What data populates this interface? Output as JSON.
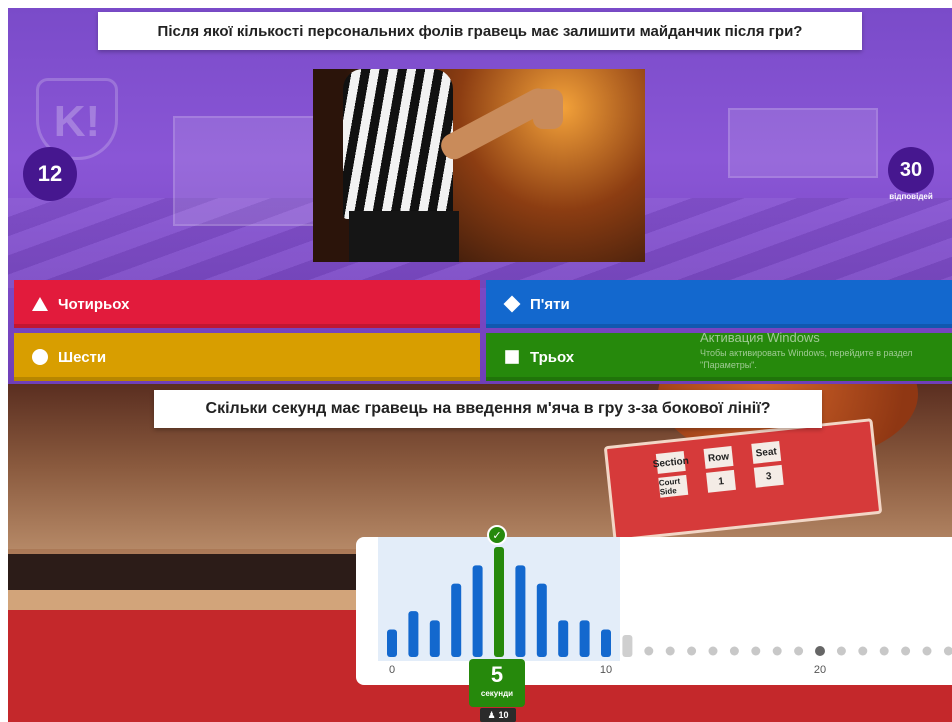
{
  "top_quiz": {
    "question": "Після якої кількості персональних фолів гравець має залишити майданчик після гри?",
    "timer": "12",
    "answers_count": "30",
    "answers_label": "відповідей",
    "crest_text": "K!",
    "answers": [
      {
        "label": "Чотирьох",
        "shape": "triangle-icon",
        "color": "#e21b3c"
      },
      {
        "label": "П'яти",
        "shape": "diamond-icon",
        "color": "#1368ce"
      },
      {
        "label": "Шести",
        "shape": "circle-icon",
        "color": "#d89e00"
      },
      {
        "label": "Трьох",
        "shape": "square-icon",
        "color": "#26890c"
      }
    ],
    "activation": {
      "title": "Активация Windows",
      "text": "Чтобы активировать Windows, перейдите в раздел \"Параметры\"."
    }
  },
  "bottom_quiz": {
    "question": "Скільки секунд має гравець на введення м'яча в гру з-за бокової лінії?",
    "tickets": [
      {
        "a": "Section",
        "b": "Court Side",
        "c": "Row",
        "d": "1",
        "e": "Seat",
        "f": "3"
      }
    ],
    "answer_value": "5",
    "answer_unit": "секунди",
    "voters": "10",
    "accent_green": "#26890c",
    "accent_blue": "#1368ce"
  },
  "chart_data": {
    "type": "bar",
    "x": [
      0,
      1,
      2,
      3,
      4,
      5,
      6,
      7,
      8,
      9,
      10
    ],
    "values": [
      3,
      5,
      4,
      8,
      10,
      12,
      10,
      8,
      4,
      4,
      3
    ],
    "highlighted_x": 5,
    "xticks": [
      "0",
      "10",
      "20"
    ],
    "x_range": [
      0,
      26
    ],
    "unanswered_dot_values": [
      11,
      12,
      13,
      14,
      15,
      16,
      17,
      18,
      19,
      20,
      21,
      22,
      23,
      24,
      25,
      26
    ],
    "marked_dot": 20,
    "range_shaded": [
      0,
      10
    ]
  }
}
